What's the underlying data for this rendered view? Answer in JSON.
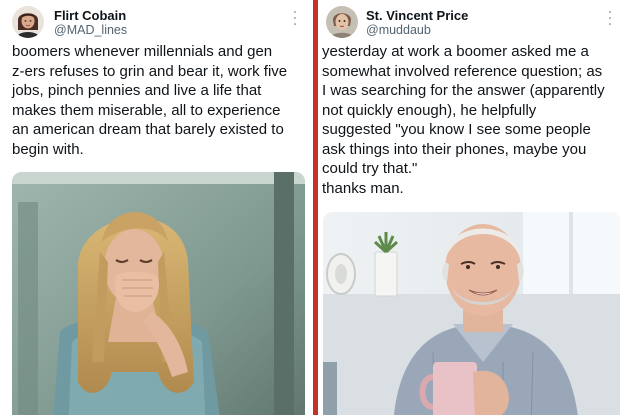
{
  "tweets": [
    {
      "author_name": "Flirt Cobain",
      "handle": "@MAD_lines",
      "text": "boomers whenever millennials and gen\nz-ers refuses to grin and bear it, work five\njobs, pinch pennies and live a life that\nmakes them miserable, all to experience\nan american dream that barely existed to\nbegin with.",
      "avatar_icon": "woman-portrait-avatar",
      "media_description_icon": "crying-woman-photo"
    },
    {
      "author_name": "St. Vincent Price",
      "handle": "@muddaub",
      "text": "yesterday at work a boomer asked me a\nsomewhat involved reference question; as\nI was searching for the answer (apparently\nnot quickly enough), he helpfully\nsuggested \"you know I see some people\nask things into their phones, maybe you\ncould try that.\"\nthanks man.",
      "avatar_icon": "vintage-portrait-avatar",
      "media_description_icon": "smiling-man-mug-photo"
    }
  ],
  "colors": {
    "divider": "#c8312b",
    "text": "#0f1419",
    "handle": "#536471"
  }
}
